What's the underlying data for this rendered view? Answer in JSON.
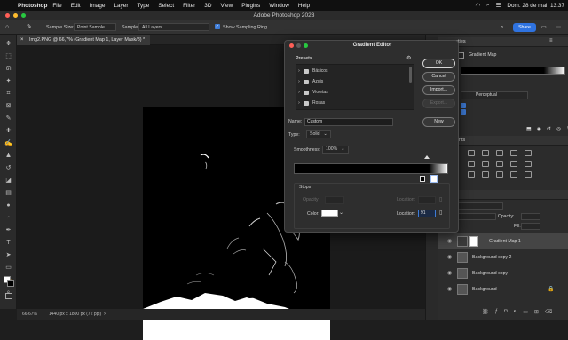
{
  "menubar": {
    "app_name": "Photoshop",
    "items": [
      "File",
      "Edit",
      "Image",
      "Layer",
      "Type",
      "Select",
      "Filter",
      "3D",
      "View",
      "Plugins",
      "Window",
      "Help"
    ],
    "datetime": "Dom. 28 de mai.  13:37"
  },
  "window": {
    "title": "Adobe Photoshop 2023"
  },
  "options": {
    "sample_size_label": "Sample Size:",
    "sample_size_value": "Point Sample",
    "sample_label": "Sample:",
    "sample_value": "All Layers",
    "show_ring_label": "Show Sampling Ring",
    "share_label": "Share"
  },
  "document": {
    "tab_title": "Img2.PNG @ 66,7% (Gradient Map 1, Layer Mask/8) *",
    "zoom": "66,67%",
    "dimensions": "1440 px x 1800 px (72 ppi)"
  },
  "panels": {
    "properties_title": "erties",
    "gradient_map_label": "Gradient Map",
    "method_label": "Perceptual",
    "adjustments_title": "ments",
    "layers_labels": {
      "opacity": "Opacity:",
      "fill": "Fill:"
    },
    "layers": [
      {
        "name": "Gradient Map 1"
      },
      {
        "name": "Background copy 2"
      },
      {
        "name": "Background copy"
      },
      {
        "name": "Background"
      }
    ]
  },
  "dialog": {
    "title": "Gradient Editor",
    "presets_label": "Presets",
    "presets": [
      {
        "name": "Básicos"
      },
      {
        "name": "Azuis"
      },
      {
        "name": "Violetas"
      },
      {
        "name": "Rosas"
      }
    ],
    "ok_label": "OK",
    "cancel_label": "Cancel",
    "import_label": "Import...",
    "export_label": "Export...",
    "new_label": "New",
    "name_label": "Name:",
    "name_value": "Custom",
    "type_label": "Type:",
    "type_value": "Solid",
    "smoothness_label": "Smoothness:",
    "smoothness_value": "100%",
    "stops_label": "Stops",
    "opacity_label": "Opacity:",
    "location_label": "Location:",
    "color_label": "Color:",
    "color_location_value": "91"
  },
  "colors": {
    "accent": "#2f73e0",
    "dialog_bg": "#2e2e2e",
    "canvas": "#000000"
  }
}
